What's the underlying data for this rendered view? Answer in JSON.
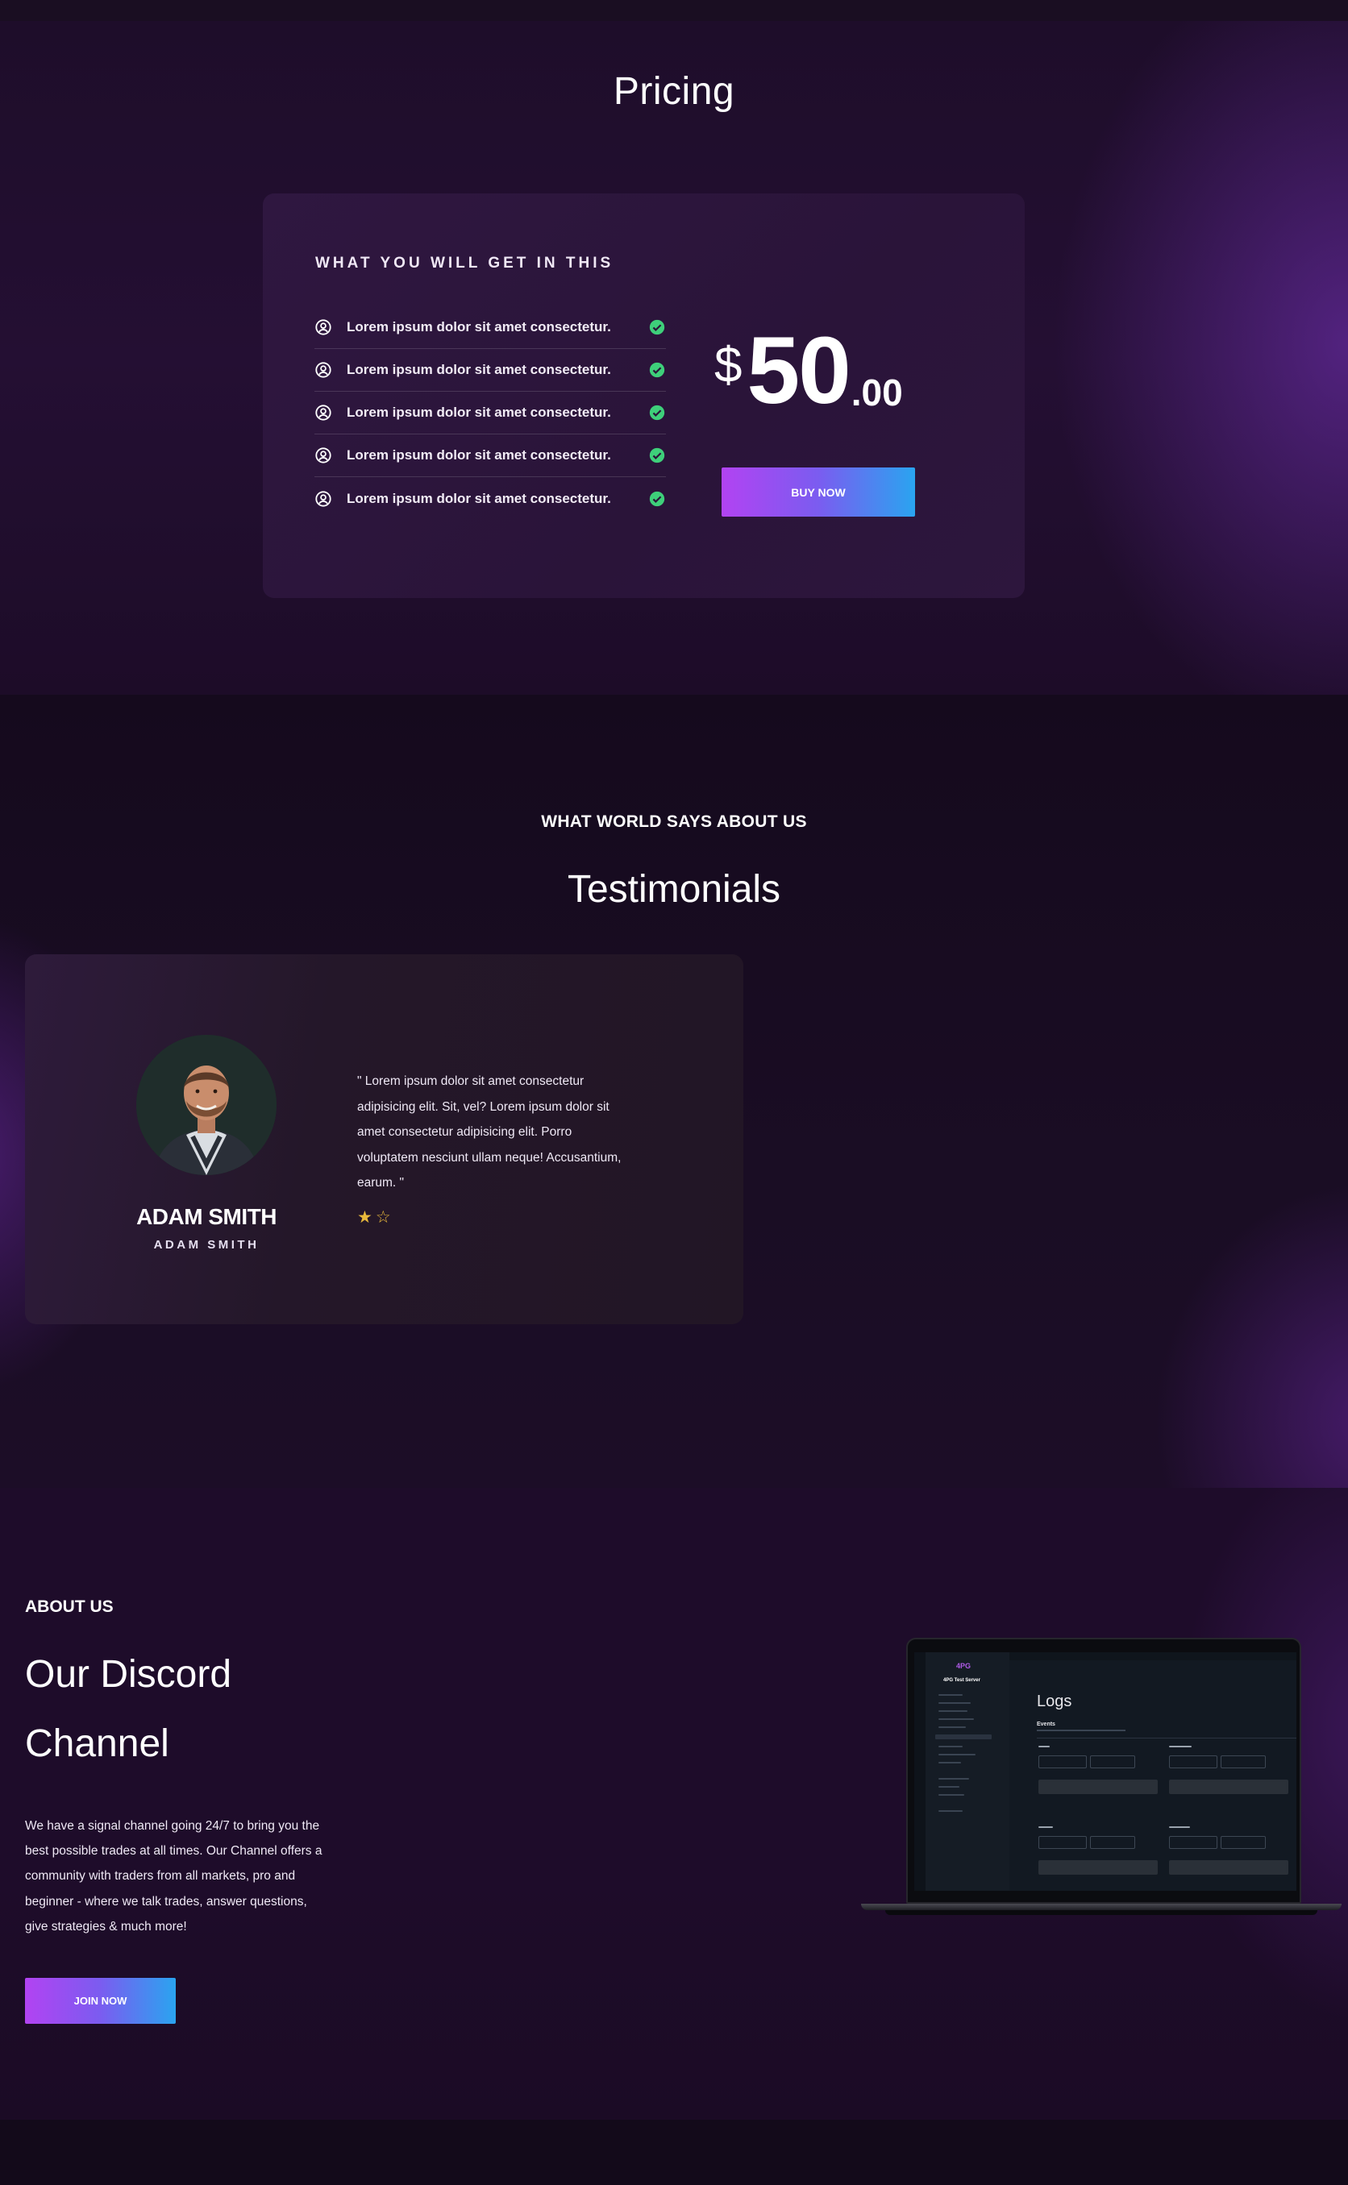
{
  "pricing": {
    "title": "Pricing",
    "card_heading": "WHAT YOU WILL GET IN THIS",
    "features": [
      "Lorem ipsum dolor sit amet consectetur.",
      "Lorem ipsum dolor sit amet consectetur.",
      "Lorem ipsum dolor sit amet consectetur.",
      "Lorem ipsum dolor sit amet consectetur.",
      "Lorem ipsum dolor sit amet consectetur."
    ],
    "currency": "$",
    "amount": "50",
    "cents": ".00",
    "buy_label": "BUY NOW",
    "icons": {
      "feature": "user-circle-icon",
      "included": "check-circle-icon"
    },
    "colors": {
      "check": "#3ecf7a",
      "button_start": "#b243f2",
      "button_end": "#2aa4f0"
    }
  },
  "testimonials": {
    "eyebrow": "WHAT WORLD SAYS ABOUT US",
    "title": "Testimonials",
    "items": [
      {
        "name": "ADAM SMITH",
        "role": "ADAM SMITH",
        "quote": "\" Lorem ipsum dolor sit amet consectetur adipisicing elit. Sit, vel? Lorem ipsum dolor sit amet consectetur adipisicing elit. Porro voluptatem nesciunt ullam neque! Accusantium, earum. \"",
        "rating": 1,
        "rating_max": 2
      }
    ],
    "colors": {
      "star": "#e9b93b"
    }
  },
  "about": {
    "eyebrow": "ABOUT US",
    "title_line1": "Our Discord",
    "title_line2": "Channel",
    "text": "We have a signal channel going 24/7 to bring you the best possible trades at all times. Our Channel offers a community with traders from all markets, pro and beginner - where we talk trades, answer questions, give strategies & much more!",
    "join_label": "JOIN NOW",
    "screenshot": {
      "brand": "4PG",
      "server": "4PG Test Server",
      "page_title": "Logs",
      "section": "Events"
    }
  }
}
